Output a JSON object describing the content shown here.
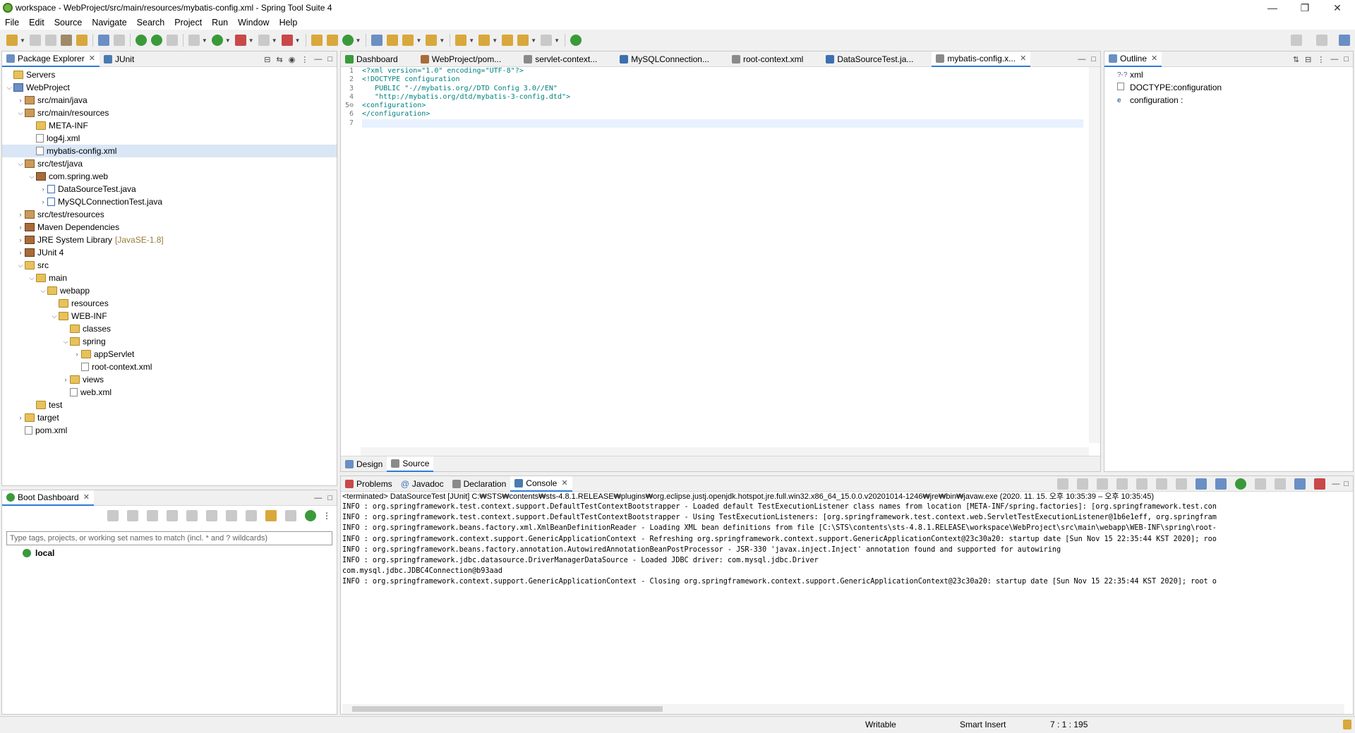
{
  "window": {
    "title": "workspace - WebProject/src/main/resources/mybatis-config.xml - Spring Tool Suite 4"
  },
  "menu": [
    "File",
    "Edit",
    "Source",
    "Navigate",
    "Search",
    "Project",
    "Run",
    "Window",
    "Help"
  ],
  "package_explorer": {
    "tabs": [
      "Package Explorer",
      "JUnit"
    ],
    "tree": [
      {
        "label": "Servers",
        "depth": 0,
        "twisty": "",
        "icon": "folder"
      },
      {
        "label": "WebProject",
        "depth": 0,
        "twisty": "v",
        "icon": "proj"
      },
      {
        "label": "src/main/java",
        "depth": 1,
        "twisty": ">",
        "icon": "pkg"
      },
      {
        "label": "src/main/resources",
        "depth": 1,
        "twisty": "v",
        "icon": "pkg"
      },
      {
        "label": "META-INF",
        "depth": 2,
        "twisty": "",
        "icon": "folder"
      },
      {
        "label": "log4j.xml",
        "depth": 2,
        "twisty": "",
        "icon": "file"
      },
      {
        "label": "mybatis-config.xml",
        "depth": 2,
        "twisty": "",
        "icon": "file",
        "selected": true
      },
      {
        "label": "src/test/java",
        "depth": 1,
        "twisty": "v",
        "icon": "pkg"
      },
      {
        "label": "com.spring.web",
        "depth": 2,
        "twisty": "v",
        "icon": "jar"
      },
      {
        "label": "DataSourceTest.java",
        "depth": 3,
        "twisty": ">",
        "icon": "java"
      },
      {
        "label": "MySQLConnectionTest.java",
        "depth": 3,
        "twisty": ">",
        "icon": "java"
      },
      {
        "label": "src/test/resources",
        "depth": 1,
        "twisty": ">",
        "icon": "pkg"
      },
      {
        "label": "Maven Dependencies",
        "depth": 1,
        "twisty": ">",
        "icon": "jar"
      },
      {
        "label": "JRE System Library",
        "depth": 1,
        "twisty": ">",
        "icon": "jar",
        "suffix": "[JavaSE-1.8]"
      },
      {
        "label": "JUnit 4",
        "depth": 1,
        "twisty": ">",
        "icon": "jar"
      },
      {
        "label": "src",
        "depth": 1,
        "twisty": "v",
        "icon": "folder"
      },
      {
        "label": "main",
        "depth": 2,
        "twisty": "v",
        "icon": "folder"
      },
      {
        "label": "webapp",
        "depth": 3,
        "twisty": "v",
        "icon": "folder"
      },
      {
        "label": "resources",
        "depth": 4,
        "twisty": "",
        "icon": "folder"
      },
      {
        "label": "WEB-INF",
        "depth": 4,
        "twisty": "v",
        "icon": "folder"
      },
      {
        "label": "classes",
        "depth": 5,
        "twisty": "",
        "icon": "folder"
      },
      {
        "label": "spring",
        "depth": 5,
        "twisty": "v",
        "icon": "folder"
      },
      {
        "label": "appServlet",
        "depth": 6,
        "twisty": ">",
        "icon": "folder"
      },
      {
        "label": "root-context.xml",
        "depth": 6,
        "twisty": "",
        "icon": "file"
      },
      {
        "label": "views",
        "depth": 5,
        "twisty": ">",
        "icon": "folder"
      },
      {
        "label": "web.xml",
        "depth": 5,
        "twisty": "",
        "icon": "file"
      },
      {
        "label": "test",
        "depth": 2,
        "twisty": "",
        "icon": "folder"
      },
      {
        "label": "target",
        "depth": 1,
        "twisty": ">",
        "icon": "folder"
      },
      {
        "label": "pom.xml",
        "depth": 1,
        "twisty": "",
        "icon": "file"
      }
    ]
  },
  "editor": {
    "tabs": [
      "Dashboard",
      "WebProject/pom...",
      "servlet-context...",
      "MySQLConnection...",
      "root-context.xml",
      "DataSourceTest.ja...",
      "mybatis-config.x..."
    ],
    "line_numbers": [
      "1",
      "2",
      "3",
      "4",
      "5⊖",
      "6",
      "7"
    ],
    "lines": [
      "<?xml version=\"1.0\" encoding=\"UTF-8\"?>",
      "<!DOCTYPE configuration",
      "   PUBLIC \"-//mybatis.org//DTD Config 3.0//EN\"",
      "   \"http://mybatis.org/dtd/mybatis-3-config.dtd\">",
      "<configuration>",
      "</configuration>",
      ""
    ],
    "bottom_tabs": [
      "Design",
      "Source"
    ]
  },
  "outline": {
    "title": "Outline",
    "items": [
      {
        "icon": "?-?",
        "label": "xml"
      },
      {
        "icon": "",
        "label": "DOCTYPE:configuration"
      },
      {
        "icon": "e",
        "label": "configuration :"
      }
    ]
  },
  "boot_dashboard": {
    "title": "Boot Dashboard",
    "search_placeholder": "Type tags, projects, or working set names to match (incl. * and ? wildcards)",
    "items": [
      "local"
    ]
  },
  "console": {
    "tabs": [
      "Problems",
      "Javadoc",
      "Declaration",
      "Console"
    ],
    "terminated": "<terminated> DataSourceTest [JUnit] C:₩STS₩contents₩sts-4.8.1.RELEASE₩plugins₩org.eclipse.justj.openjdk.hotspot.jre.full.win32.x86_64_15.0.0.v20201014-1246₩jre₩bin₩javaw.exe  (2020. 11. 15. 오후 10:35:39 – 오후 10:35:45)",
    "lines": [
      "INFO : org.springframework.test.context.support.DefaultTestContextBootstrapper - Loaded default TestExecutionListener class names from location [META-INF/spring.factories]: [org.springframework.test.con",
      "INFO : org.springframework.test.context.support.DefaultTestContextBootstrapper - Using TestExecutionListeners: [org.springframework.test.context.web.ServletTestExecutionListener@1b6e1eff, org.springfram",
      "INFO : org.springframework.beans.factory.xml.XmlBeanDefinitionReader - Loading XML bean definitions from file [C:\\STS\\contents\\sts-4.8.1.RELEASE\\workspace\\WebProject\\src\\main\\webapp\\WEB-INF\\spring\\root-",
      "INFO : org.springframework.context.support.GenericApplicationContext - Refreshing org.springframework.context.support.GenericApplicationContext@23c30a20: startup date [Sun Nov 15 22:35:44 KST 2020]; roo",
      "INFO : org.springframework.beans.factory.annotation.AutowiredAnnotationBeanPostProcessor - JSR-330 'javax.inject.Inject' annotation found and supported for autowiring",
      "INFO : org.springframework.jdbc.datasource.DriverManagerDataSource - Loaded JDBC driver: com.mysql.jdbc.Driver",
      "com.mysql.jdbc.JDBC4Connection@b93aad",
      "INFO : org.springframework.context.support.GenericApplicationContext - Closing org.springframework.context.support.GenericApplicationContext@23c30a20: startup date [Sun Nov 15 22:35:44 KST 2020]; root o"
    ]
  },
  "status": {
    "writable": "Writable",
    "insert_mode": "Smart Insert",
    "position": "7 : 1 : 195"
  },
  "colors": {
    "accent": "#2e7bd6",
    "spring_green": "#6db33f",
    "xml_tag": "#008080"
  }
}
